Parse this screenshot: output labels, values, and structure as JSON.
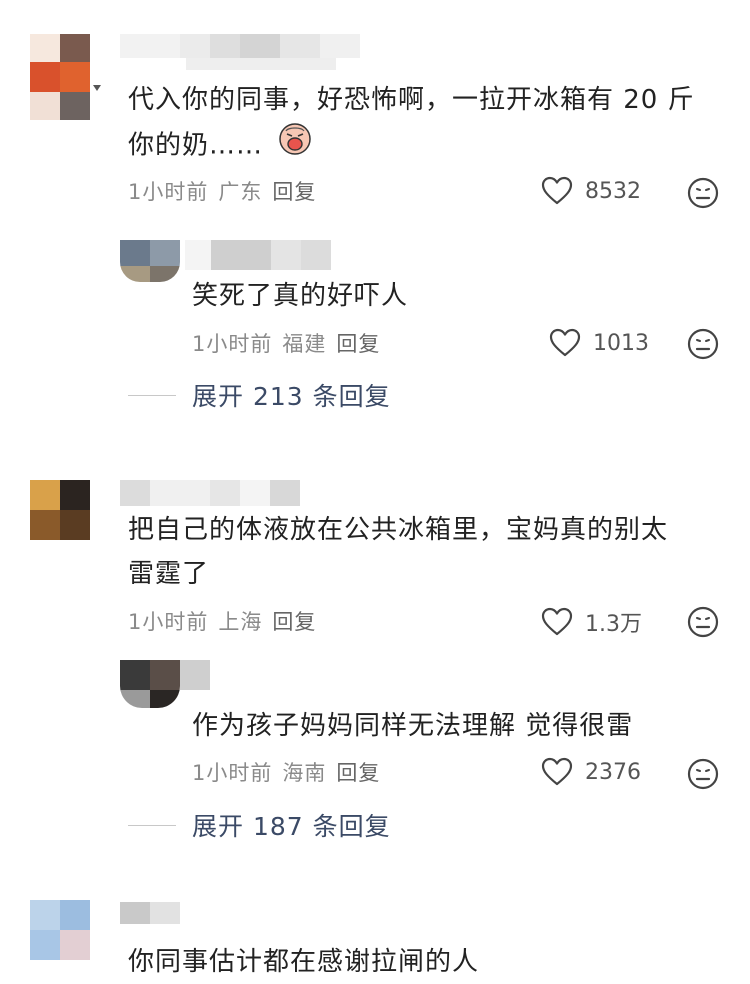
{
  "comments": [
    {
      "text_line1": "代入你的同事，好恐怖啊，一拉开冰箱有 20 斤",
      "text_line2": "你的奶……",
      "time": "1小时前",
      "location": "广东",
      "reply_label": "回复",
      "likes": "8532",
      "sub_reply": {
        "text": "笑死了真的好吓人",
        "time": "1小时前",
        "location": "福建",
        "reply_label": "回复",
        "likes": "1013"
      },
      "expand_label": "展开 213 条回复"
    },
    {
      "text_line1": "把自己的体液放在公共冰箱里，宝妈真的别太",
      "text_line2": "雷霆了",
      "time": "1小时前",
      "location": "上海",
      "reply_label": "回复",
      "likes": "1.3万",
      "sub_reply": {
        "text": "作为孩子妈妈同样无法理解 觉得很雷",
        "time": "1小时前",
        "location": "海南",
        "reply_label": "回复",
        "likes": "2376"
      },
      "expand_label": "展开 187 条回复"
    },
    {
      "text_line1": "你同事估计都在感谢拉闸的人"
    }
  ],
  "icons": {
    "like": "heart-outline-icon",
    "more": "emoji-face-icon"
  },
  "colors": {
    "text": "#222222",
    "meta": "#8a8a8a",
    "expand": "#3b4a66"
  }
}
